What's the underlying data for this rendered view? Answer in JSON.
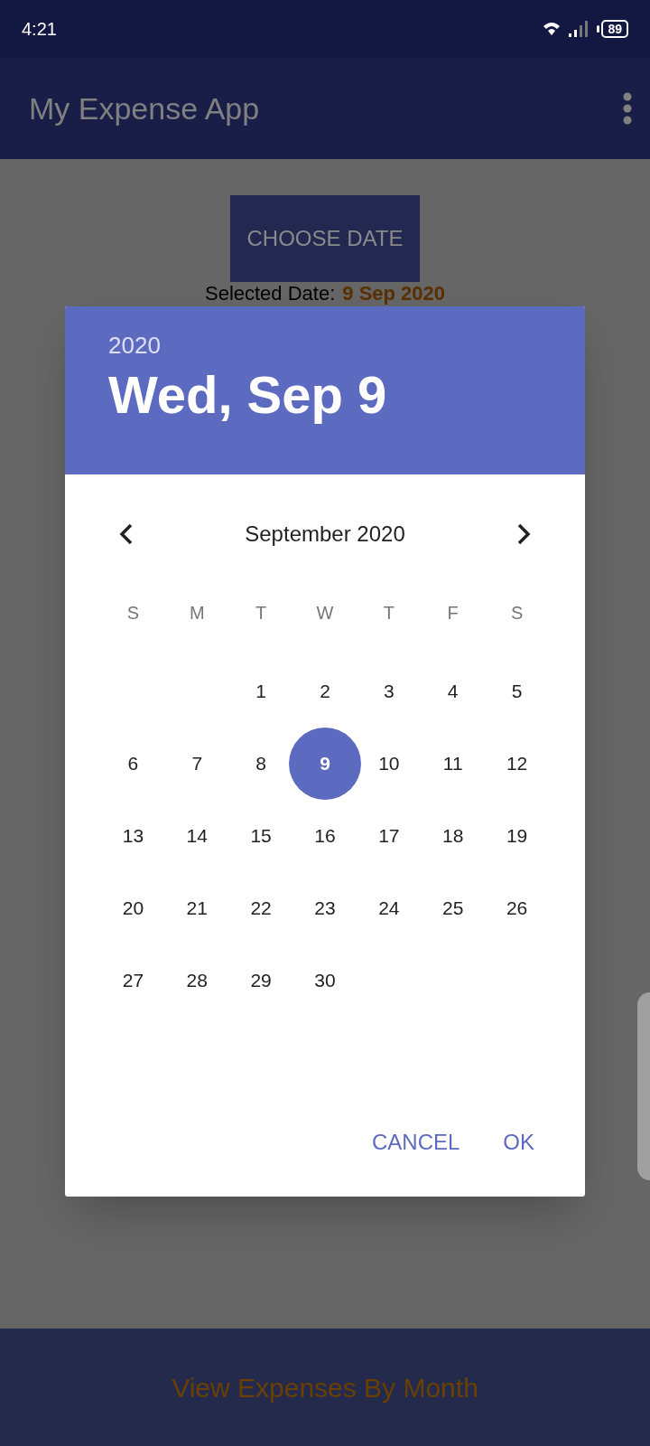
{
  "status_bar": {
    "time": "4:21",
    "battery": "89"
  },
  "app_bar": {
    "title": "My Expense App"
  },
  "choose_date_button": "CHOOSE DATE",
  "selected_date": {
    "label": "Selected Date:",
    "value": "9 Sep 2020"
  },
  "date_picker": {
    "year": "2020",
    "date": "Wed, Sep 9",
    "month": "September 2020",
    "weekdays": [
      "S",
      "M",
      "T",
      "W",
      "T",
      "F",
      "S"
    ],
    "weeks": [
      [
        {
          "label": "1",
          "selected": false
        },
        {
          "label": "2",
          "selected": false
        },
        {
          "label": "3",
          "selected": false
        },
        {
          "label": "4",
          "selected": false
        },
        {
          "label": "5",
          "selected": false
        }
      ],
      [
        {
          "label": "6",
          "selected": false
        },
        {
          "label": "7",
          "selected": false
        },
        {
          "label": "8",
          "selected": false
        },
        {
          "label": "9",
          "selected": true
        },
        {
          "label": "10",
          "selected": false
        },
        {
          "label": "11",
          "selected": false
        },
        {
          "label": "12",
          "selected": false
        }
      ],
      [
        {
          "label": "13",
          "selected": false
        },
        {
          "label": "14",
          "selected": false
        },
        {
          "label": "15",
          "selected": false
        },
        {
          "label": "16",
          "selected": false
        },
        {
          "label": "17",
          "selected": false
        },
        {
          "label": "18",
          "selected": false
        },
        {
          "label": "19",
          "selected": false
        }
      ],
      [
        {
          "label": "20",
          "selected": false
        },
        {
          "label": "21",
          "selected": false
        },
        {
          "label": "22",
          "selected": false
        },
        {
          "label": "23",
          "selected": false
        },
        {
          "label": "24",
          "selected": false
        },
        {
          "label": "25",
          "selected": false
        },
        {
          "label": "26",
          "selected": false
        }
      ],
      [
        {
          "label": "27",
          "selected": false
        },
        {
          "label": "28",
          "selected": false
        },
        {
          "label": "29",
          "selected": false
        },
        {
          "label": "30",
          "selected": false
        }
      ]
    ],
    "buttons": [
      "CANCEL",
      "OK"
    ]
  },
  "bottom_button": "View Expenses By Month"
}
